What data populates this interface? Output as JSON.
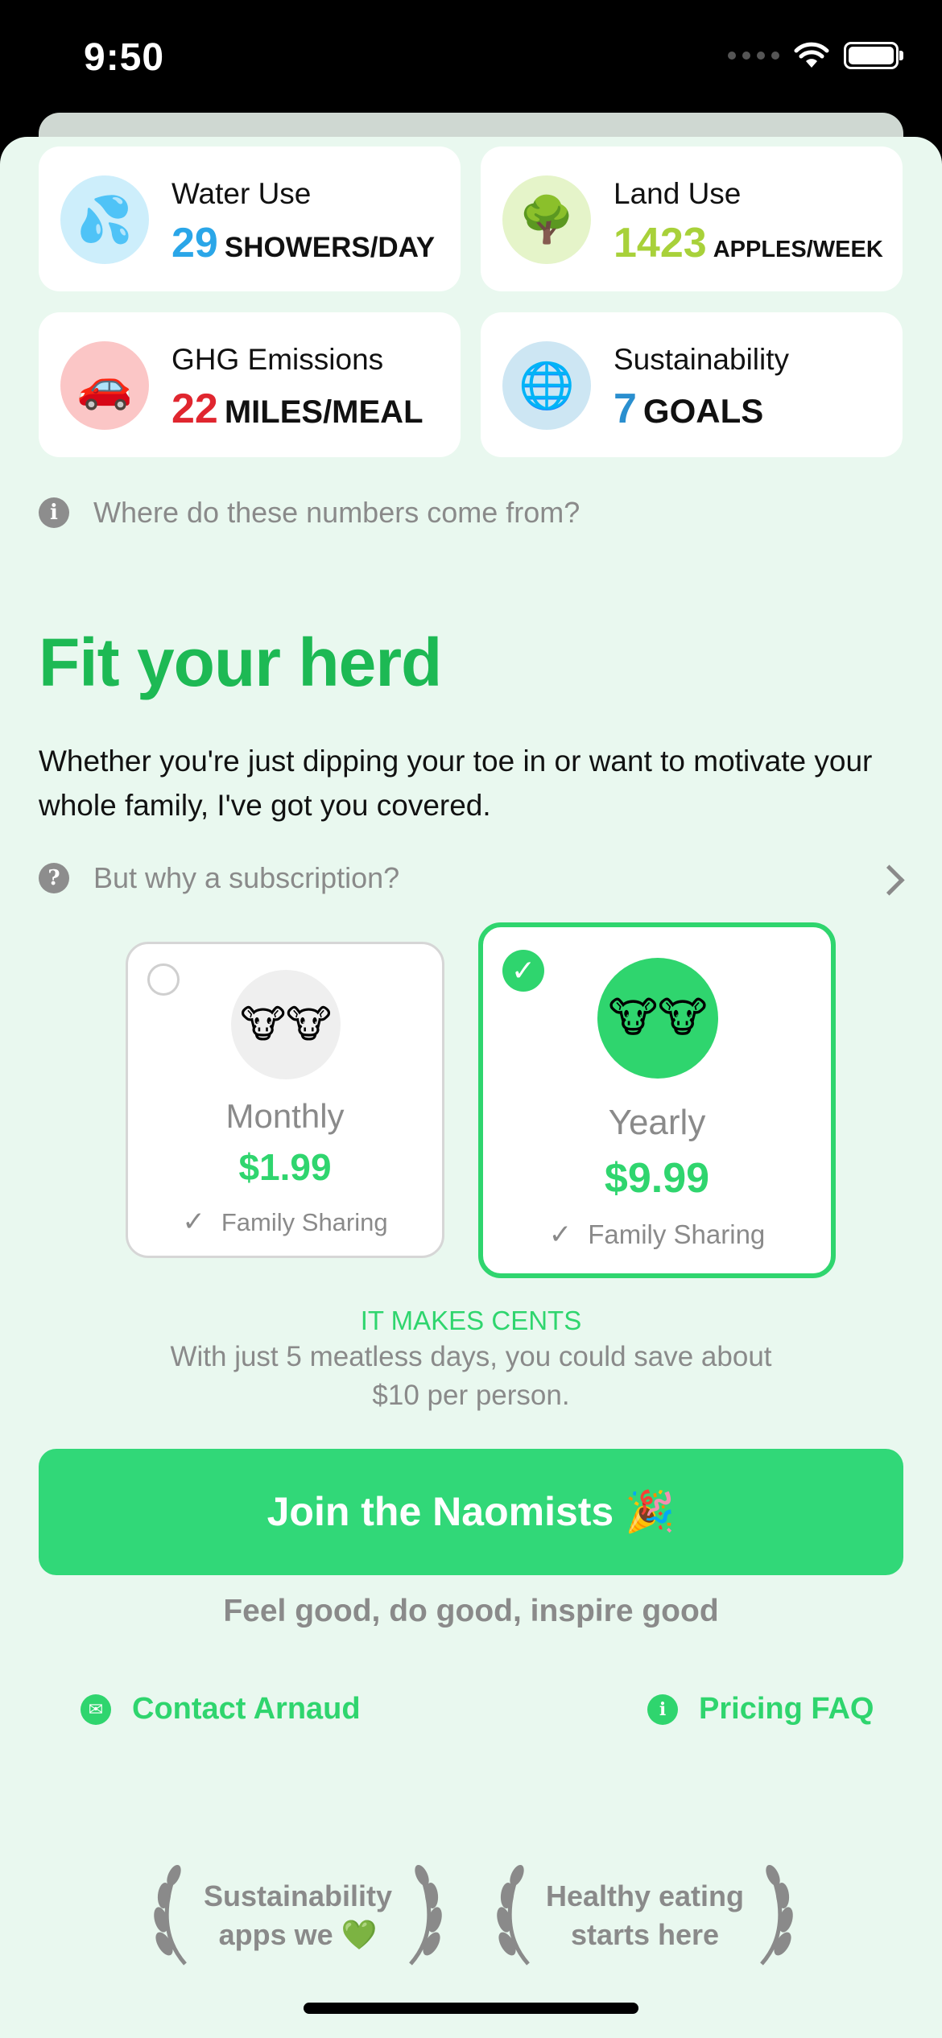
{
  "status_bar": {
    "time": "9:50"
  },
  "stats": [
    {
      "label": "Water Use",
      "value": "29",
      "unit": "SHOWERS/DAY",
      "icon": "droplets-icon",
      "icon_glyph": "💦",
      "value_color": "#2aa6e8",
      "icon_bg": "#cdeefb"
    },
    {
      "label": "Land Use",
      "value": "1423",
      "unit": "APPLES/WEEK",
      "icon": "tree-icon",
      "icon_glyph": "🌳",
      "value_color": "#a8d13a",
      "icon_bg": "#e5f4c9"
    },
    {
      "label": "GHG Emissions",
      "value": "22",
      "unit": "MILES/MEAL",
      "icon": "car-icon",
      "icon_glyph": "🚗",
      "value_color": "#e0262f",
      "icon_bg": "#fbc6c6"
    },
    {
      "label": "Sustainability",
      "value": "7",
      "unit": "GOALS",
      "icon": "globe-icon",
      "icon_glyph": "🌐",
      "value_color": "#2a8fcf",
      "icon_bg": "#cde6f3"
    }
  ],
  "numbers_info": {
    "text": "Where do these numbers come from?"
  },
  "pricing": {
    "title": "Fit your herd",
    "description": "Whether you're just dipping your toe in or want to motivate your whole family, I've got you covered.",
    "why_subscription": "But why a subscription?",
    "plans": [
      {
        "name": "Monthly",
        "price": "$1.99",
        "feature": "Family Sharing",
        "selected": false
      },
      {
        "name": "Yearly",
        "price": "$9.99",
        "feature": "Family Sharing",
        "selected": true
      }
    ],
    "cents_title": "IT MAKES CENTS",
    "cents_text": "With just 5 meatless days, you could save about $10 per person."
  },
  "cta": {
    "label": "Join the Naomists 🎉",
    "tagline": "Feel good, do good, inspire good"
  },
  "links": {
    "contact": "Contact Arnaud",
    "faq": "Pricing FAQ"
  },
  "awards": [
    {
      "line1": "Sustainability",
      "line2": "apps we 💚"
    },
    {
      "line1": "Healthy eating",
      "line2": "starts here"
    }
  ],
  "colors": {
    "accent": "#2fd56e",
    "title_green": "#1db954",
    "background": "#e9f8ef"
  }
}
